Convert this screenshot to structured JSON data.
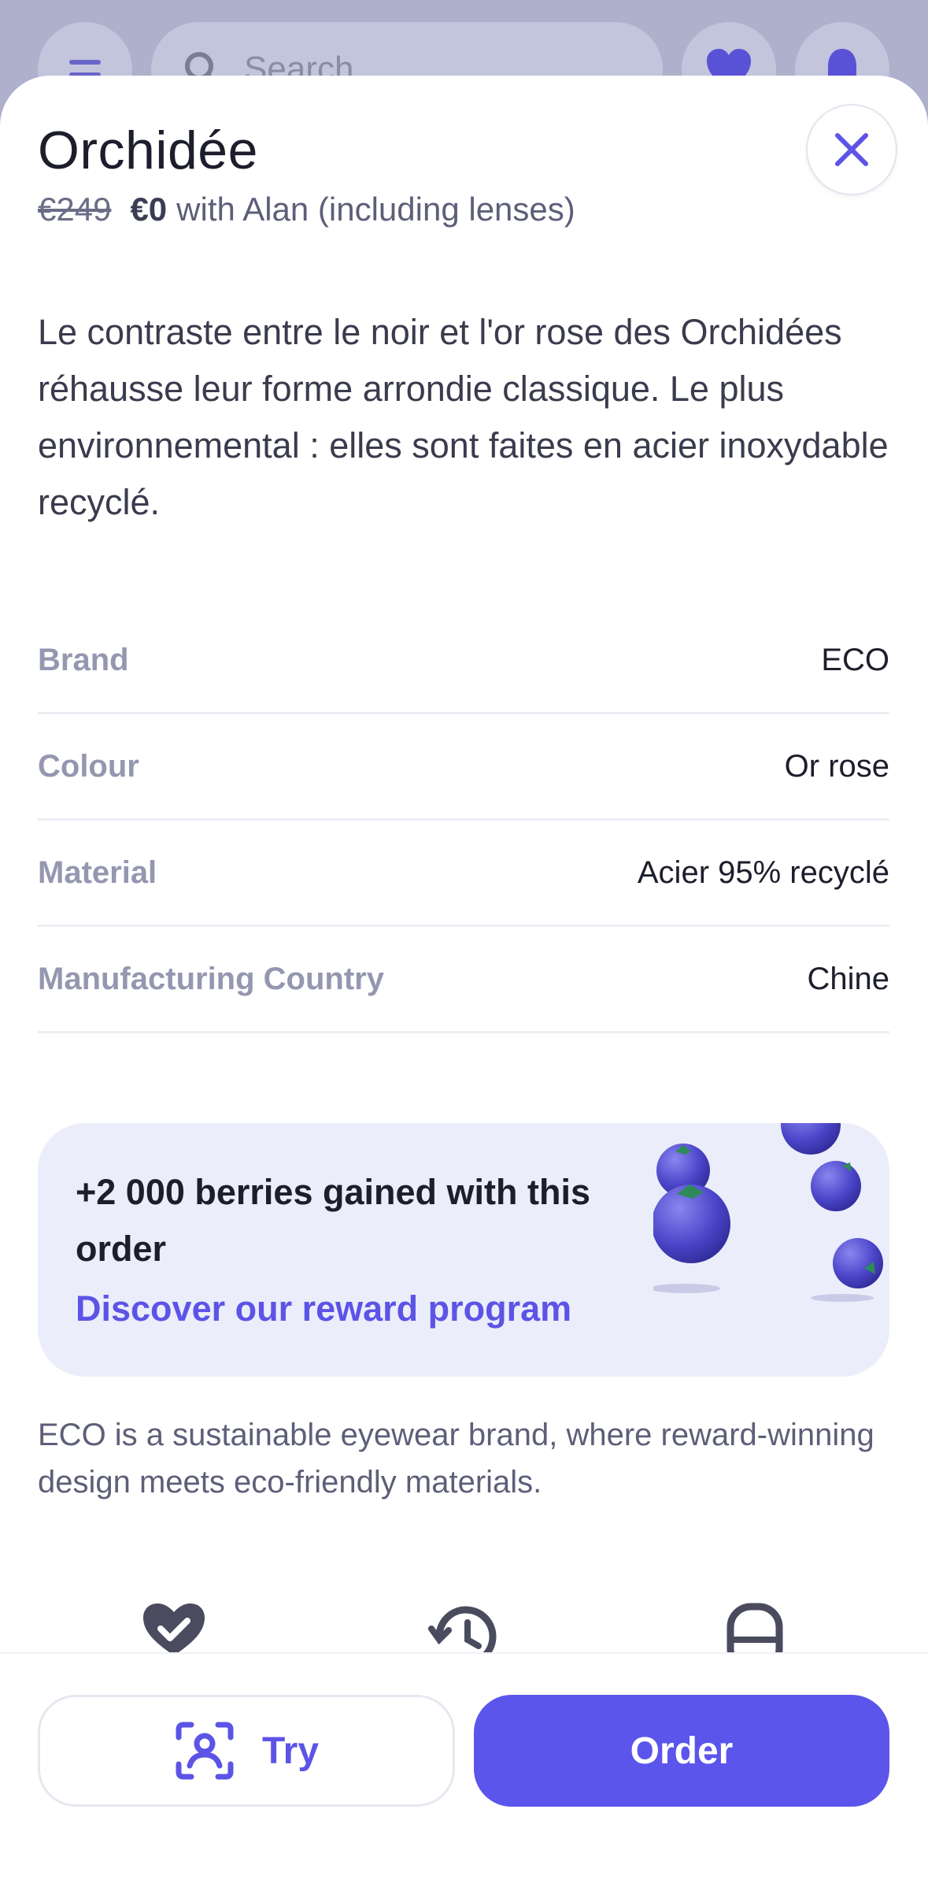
{
  "background": {
    "search_placeholder": "Search",
    "menu_icon": "menu-icon",
    "search_icon": "search-icon",
    "heart_icon": "heart-icon",
    "bell_icon": "bell-icon"
  },
  "product": {
    "title": "Orchidée",
    "old_price": "€249",
    "new_price": "€0",
    "price_note": "with Alan (including lenses)",
    "description": "Le contraste entre le noir et l'or rose des Orchidées réhausse leur forme arrondie classique. Le plus environnemental : elles sont faites en acier inoxydable recyclé."
  },
  "specs": [
    {
      "label": "Brand",
      "value": "ECO"
    },
    {
      "label": "Colour",
      "value": "Or rose"
    },
    {
      "label": "Material",
      "value": "Acier 95% recyclé"
    },
    {
      "label": "Manufacturing Country",
      "value": "Chine"
    }
  ],
  "reward": {
    "title": "+2 000 berries gained with this order",
    "link": "Discover our reward program"
  },
  "brand_text": "ECO is a sustainable eyewear brand, where reward-winning design meets eco-friendly materials.",
  "actions": {
    "try_label": "Try",
    "order_label": "Order"
  },
  "colors": {
    "accent": "#5b55ec",
    "link": "#5c54e6",
    "card_bg": "#ebedfb"
  }
}
